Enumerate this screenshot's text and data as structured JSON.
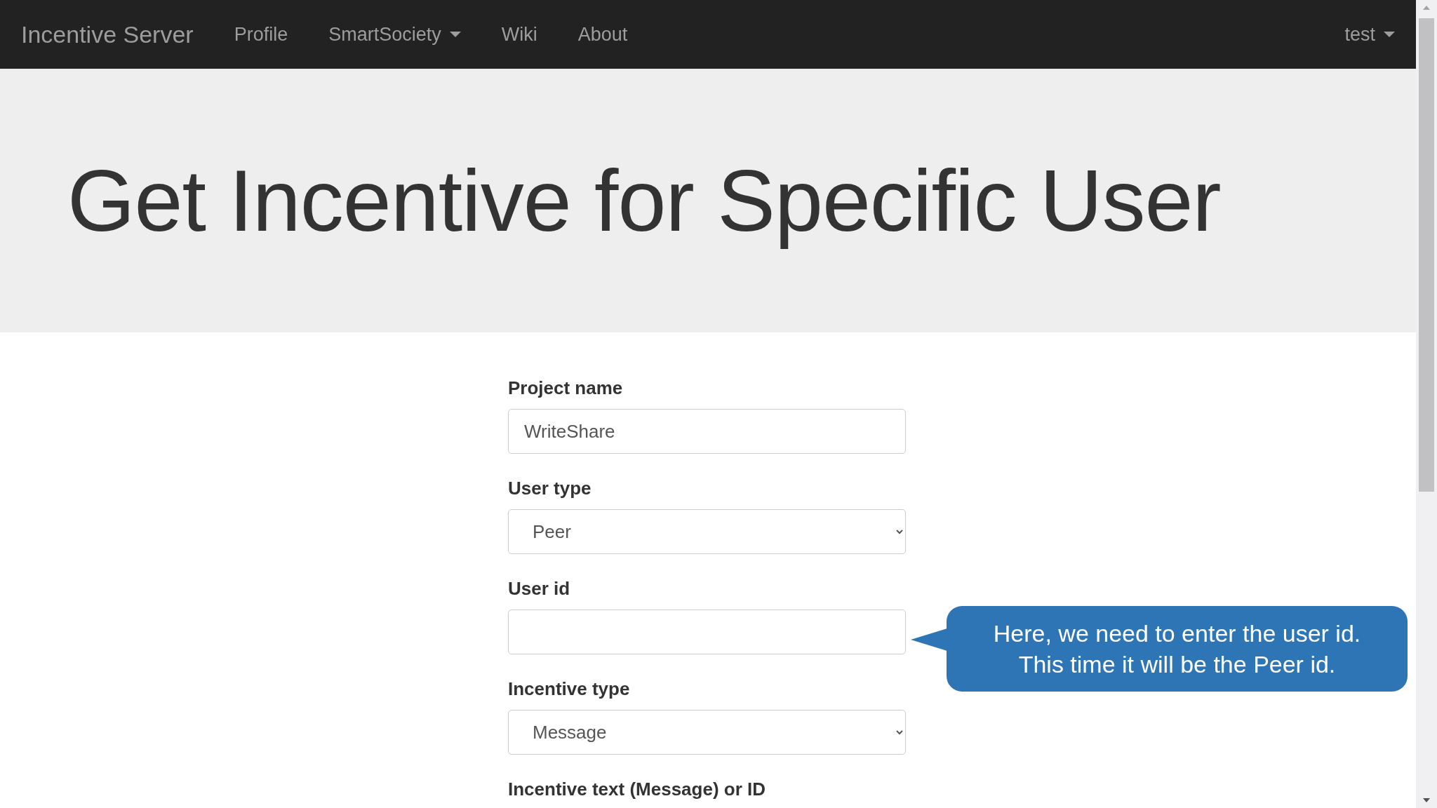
{
  "navbar": {
    "brand": "Incentive Server",
    "items": [
      {
        "label": "Profile",
        "dropdown": false
      },
      {
        "label": "SmartSociety",
        "dropdown": true
      },
      {
        "label": "Wiki",
        "dropdown": false
      },
      {
        "label": "About",
        "dropdown": false
      }
    ],
    "user_menu": {
      "label": "test",
      "dropdown": true
    }
  },
  "heading": "Get Incentive for Specific User",
  "form": {
    "fields": [
      {
        "label": "Project name",
        "kind": "text",
        "value": "WriteShare"
      },
      {
        "label": "User type",
        "kind": "select",
        "value": "Peer"
      },
      {
        "label": "User id",
        "kind": "text"
      },
      {
        "label": "Incentive type",
        "kind": "select",
        "value": "Message"
      },
      {
        "label": "Incentive text (Message) or ID",
        "kind": "label_only"
      }
    ]
  },
  "callout": {
    "text": "Here, we need to enter the user id.\nThis time it will be the Peer id."
  }
}
